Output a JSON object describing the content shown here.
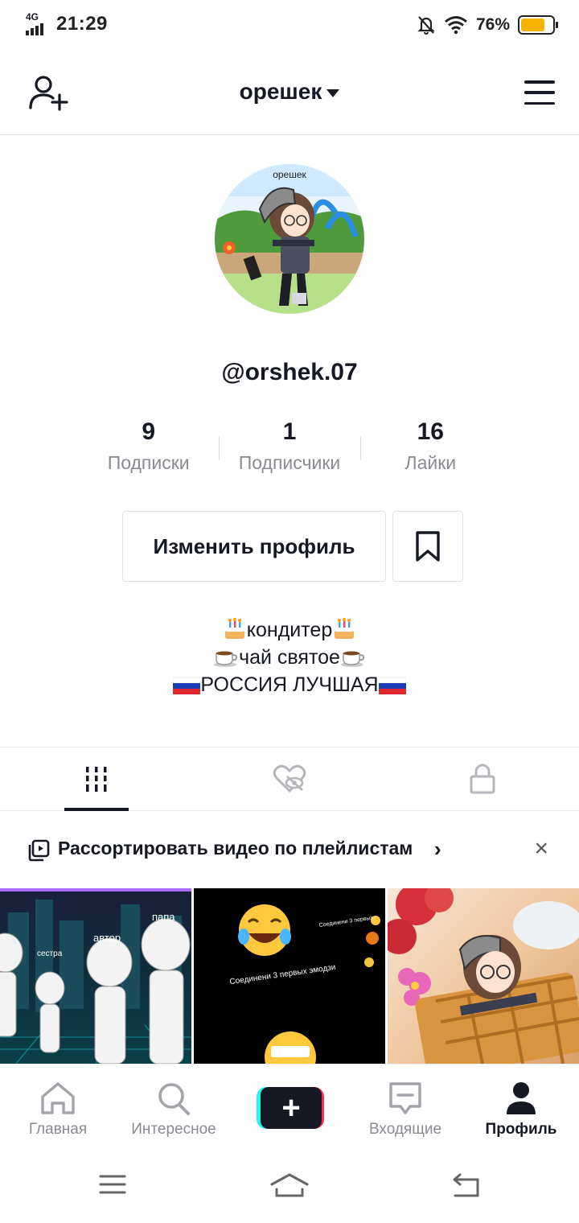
{
  "status_bar": {
    "network": "4G",
    "time": "21:29",
    "battery_percent": "76%",
    "battery_level": 0.76
  },
  "header": {
    "account_name": "орешек"
  },
  "profile": {
    "avatar_caption": "орешек",
    "username": "@orshek.07",
    "stats": [
      {
        "value": "9",
        "label": "Подписки"
      },
      {
        "value": "1",
        "label": "Подписчики"
      },
      {
        "value": "16",
        "label": "Лайки"
      }
    ],
    "edit_button": "Изменить профиль",
    "bio": {
      "line1": "кондитер",
      "line2": "чай святое",
      "line3": "РОССИЯ ЛУЧШАЯ"
    }
  },
  "playlist_banner": {
    "text": "Рассортировать видео по плейлистам",
    "chevron": "›",
    "close": "×"
  },
  "thumbnails": [
    {
      "labels": [
        "папа",
        "автор",
        "сестра"
      ]
    },
    {
      "labels": [
        "Соединени 3 первых эмодзи"
      ]
    },
    {
      "labels": []
    }
  ],
  "bottom_nav": [
    {
      "label": "Главная",
      "icon": "home-icon"
    },
    {
      "label": "Интересное",
      "icon": "search-icon"
    },
    {
      "label": "",
      "icon": "plus-icon"
    },
    {
      "label": "Входящие",
      "icon": "inbox-icon"
    },
    {
      "label": "Профиль",
      "icon": "profile-icon",
      "active": true
    }
  ]
}
